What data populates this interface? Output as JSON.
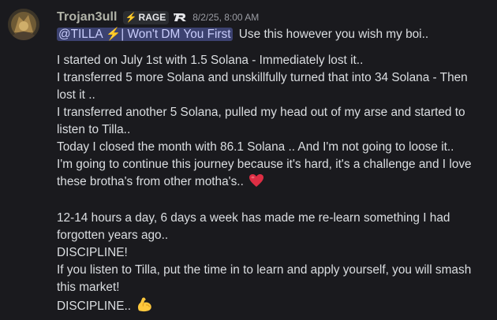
{
  "message": {
    "author": "Trojan3ull",
    "tag_label": "RAGE",
    "tag_icon": "lightning-bolt",
    "badge_icon": "r-logo-badge",
    "timestamp": "8/2/25, 8:00 AM",
    "mention": "@TILLA ⚡| Won't DM You First",
    "first_line_text": "Use this however you wish my boi..",
    "lines": [
      "I started on July 1st with 1.5 Solana - Immediately lost it..",
      "I transferred 5 more Solana and unskillfully turned that into 34 Solana - Then",
      "lost it ..",
      "I transferred another 5 Solana, pulled my head out of my arse and started to",
      "listen to Tilla..",
      "Today I closed the month with 86.1 Solana .. And I'm not going to loose it..",
      "I'm going to continue this journey because it's hard, it's a challenge and I love",
      "these brotha's from other motha's..",
      "",
      "12-14 hours a day, 6 days a week has made me re-learn something I had",
      "forgotten years ago..",
      "DISCIPLINE!",
      "If you listen to Tilla, put the time in to learn and apply yourself, you will smash",
      "this market!",
      "DISCIPLINE.."
    ],
    "emojis": {
      "heart": "red-heart-emoji",
      "muscle": "flexed-biceps-emoji"
    },
    "colors": {
      "background": "#1a1a1e",
      "username": "#b1b3a8",
      "mention_bg": "#3c4270",
      "mention_text": "#c9cdfb",
      "text": "#dbdee1",
      "timestamp": "#9a9ca3"
    }
  }
}
